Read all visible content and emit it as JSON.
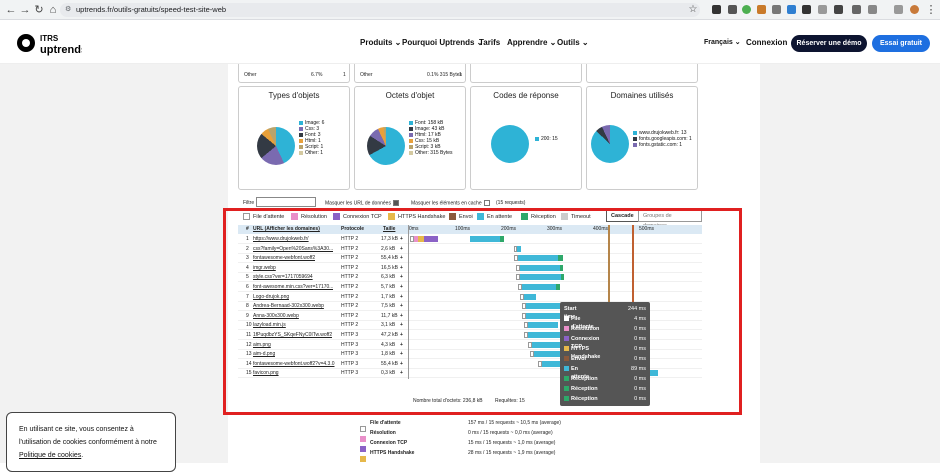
{
  "browser": {
    "url": "uptrends.fr/outils-gratuits/speed-test-site-web"
  },
  "site": {
    "logo_top": "ITRS",
    "logo_bottom": "uptrends",
    "nav": [
      "Produits",
      "Pourquoi Uptrends",
      "Tarifs",
      "Apprendre",
      "Outils"
    ],
    "language": "Français",
    "login": "Connexion",
    "demo_button": "Réserver une démo",
    "trial_button": "Essai gratuit"
  },
  "top_rows": [
    {
      "label": "Other",
      "pct": "6.7%",
      "count": "1"
    },
    {
      "label": "Other",
      "pct": "0.1% 315 Bytes",
      "count": "1"
    }
  ],
  "cards": [
    {
      "title": "Types d'objets",
      "legend": [
        "Image: 6",
        "Css: 3",
        "Font: 3",
        "Html: 1",
        "Script: 1",
        "Other: 1"
      ]
    },
    {
      "title": "Octets d'objet",
      "legend": [
        "Font: 158 kB",
        "Image: 43 kB",
        "Html: 17 kB",
        "Css: 15 kB",
        "Script: 3 kB",
        "Other: 315 Bytes"
      ]
    },
    {
      "title": "Codes de réponse",
      "legend": [
        "200: 15"
      ]
    },
    {
      "title": "Domaines utilisés",
      "legend": [
        "www.drujokweb.fr: 13",
        "fonts.googleapis.com: 1",
        "fonts.gstatic.com: 1"
      ]
    }
  ],
  "filter": {
    "label": "Filtre",
    "mask_data_urls": "Masquer les URL de données",
    "mask_cache": "Masquer les éléments en cache",
    "requests": "(15 requests)"
  },
  "waterfall": {
    "legend": [
      "File d'attente",
      "Résolution",
      "Connexion TCP",
      "HTTPS Handshake",
      "Envoi",
      "En attente",
      "Réception",
      "Timeout"
    ],
    "colors": {
      "queue": "#ffffff",
      "dns": "#e98fc9",
      "tcp": "#8b62c6",
      "ssl": "#e6b84a",
      "send": "#8b5a3c",
      "wait": "#3fb8d8",
      "receive": "#2ea86a",
      "timeout": "#cccccc"
    },
    "buttons": {
      "cascade": "Cascade",
      "groups": "Groupes de domaines"
    },
    "headers": {
      "num": "#",
      "url": "URL (Afficher les domaines)",
      "protocol": "Protocole",
      "size": "Taille"
    },
    "ticks": [
      "0ms",
      "100ms",
      "200ms",
      "300ms",
      "400ms",
      "500ms"
    ],
    "rows": [
      {
        "n": "1",
        "url": "https://www.drujokweb.fr/",
        "proto": "HTTP 2",
        "size": "17,3 kB"
      },
      {
        "n": "2",
        "url": "css?family=Open%20Sans%3A30...",
        "proto": "HTTP 2",
        "size": "2,6 kB"
      },
      {
        "n": "3",
        "url": "fontawesome-webfont.woff2",
        "proto": "HTTP 2",
        "size": "55,4 kB"
      },
      {
        "n": "4",
        "url": "imgr.webp",
        "proto": "HTTP 2",
        "size": "16,5 kB"
      },
      {
        "n": "5",
        "url": "style.css?ver=1717059694",
        "proto": "HTTP 2",
        "size": "6,3 kB"
      },
      {
        "n": "6",
        "url": "font-awesome.min.css?ver=17170...",
        "proto": "HTTP 2",
        "size": "5,7 kB"
      },
      {
        "n": "7",
        "url": "Logo-drujok.png",
        "proto": "HTTP 2",
        "size": "1,7 kB"
      },
      {
        "n": "8",
        "url": "Andrea-Bernaad-302x300.webp",
        "proto": "HTTP 2",
        "size": "7,5 kB"
      },
      {
        "n": "9",
        "url": "Anna-300x300.webp",
        "proto": "HTTP 2",
        "size": "11,7 kB"
      },
      {
        "n": "10",
        "url": "lazyload.min.js",
        "proto": "HTTP 2",
        "size": "3,1 kB"
      },
      {
        "n": "11",
        "url": "1fPuqdbzYS_SKqeFNyC0ITw.woff2",
        "proto": "HTTP 3",
        "size": "47,2 kB"
      },
      {
        "n": "12",
        "url": "aim.png",
        "proto": "HTTP 3",
        "size": "4,3 kB"
      },
      {
        "n": "13",
        "url": "aim-d.png",
        "proto": "HTTP 3",
        "size": "1,8 kB"
      },
      {
        "n": "14",
        "url": "fontawesome-webfont.woff2?v=4.3.0",
        "proto": "HTTP 3",
        "size": "55,4 kB"
      },
      {
        "n": "15",
        "url": "favicon.png",
        "proto": "HTTP 3",
        "size": "0,3 kB"
      }
    ],
    "plus": "+",
    "total_label": "Nombre total d'octets: 236,8 kB",
    "requests_label": "Requêtes: 15"
  },
  "tooltip": [
    {
      "label": "Start time",
      "value": "244 ms"
    },
    {
      "label": "File d'attente",
      "value": "4 ms"
    },
    {
      "label": "Résolution",
      "value": "0 ms"
    },
    {
      "label": "Connexion TCP",
      "value": "0 ms"
    },
    {
      "label": "HTTPS Handshake",
      "value": "0 ms"
    },
    {
      "label": "Envoi",
      "value": "0 ms"
    },
    {
      "label": "En attente",
      "value": "89 ms"
    },
    {
      "label": "Réception",
      "value": "0 ms"
    },
    {
      "label": "Réception",
      "value": "0 ms"
    },
    {
      "label": "Réception",
      "value": "0 ms"
    }
  ],
  "summary": [
    {
      "label": "File d'attente",
      "value": "157 ms / 15 requests ~ 10,5 ms (average)"
    },
    {
      "label": "Résolution",
      "value": "0 ms / 15 requests ~ 0,0 ms (average)"
    },
    {
      "label": "Connexion TCP",
      "value": "15 ms / 15 requests ~ 1,0 ms (average)"
    },
    {
      "label": "HTTPS Handshake",
      "value": "28 ms / 15 requests ~ 1,9 ms (average)"
    }
  ],
  "cookie": {
    "line1": "En utilisant ce site, vous consentez à",
    "line2": "l'utilisation de cookies conformément à notre",
    "link": "Politique de cookies",
    "end": "."
  }
}
